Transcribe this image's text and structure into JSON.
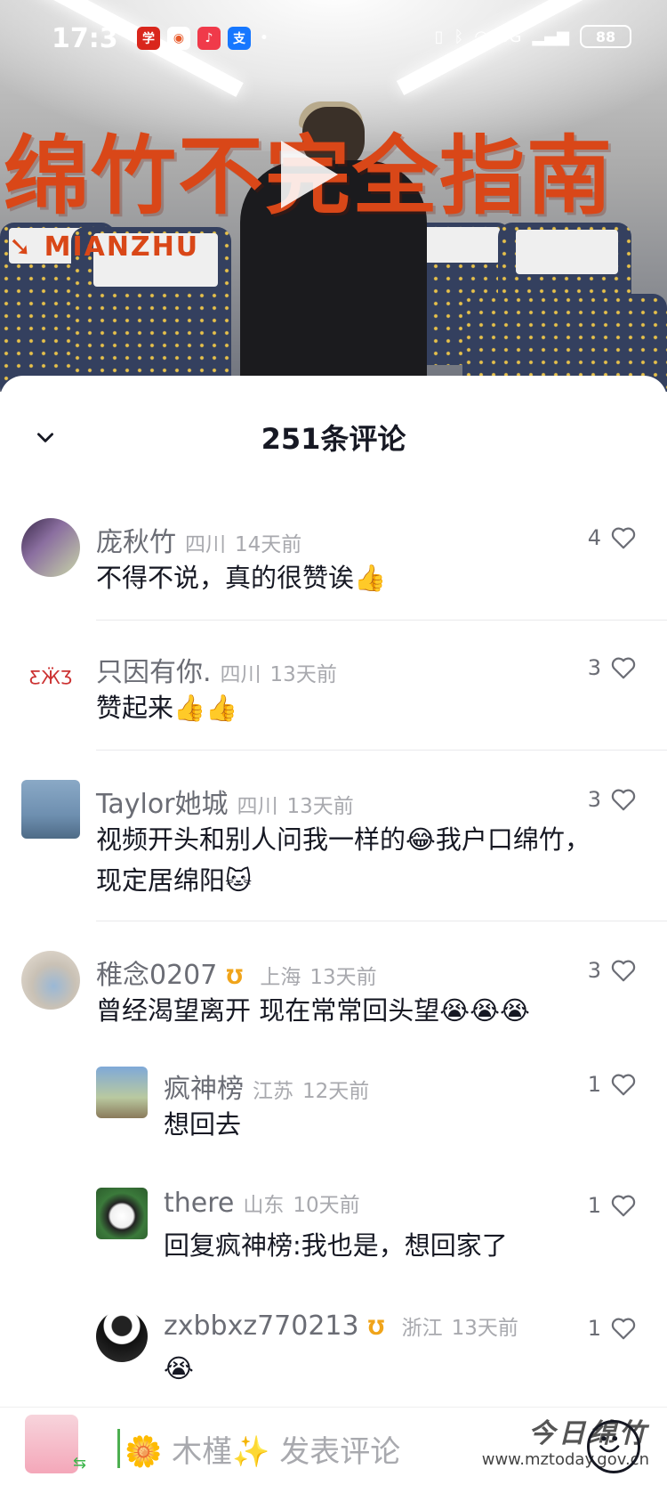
{
  "status_bar": {
    "time": "17:3",
    "battery": "88",
    "network": "5G"
  },
  "video": {
    "title_overlay": "绵竹不完全指南",
    "subtitle_overlay": "MIANZHU"
  },
  "comments_panel": {
    "title": "251条评论",
    "comments": [
      {
        "name": "庞秋竹",
        "location": "四川",
        "time": "14天前",
        "likes": "4",
        "text": "不得不说，真的很赞诶👍"
      },
      {
        "name": "只因有你.",
        "location": "四川",
        "time": "13天前",
        "likes": "3",
        "text": "赞起来👍👍"
      },
      {
        "name": "Taylor她城",
        "location": "四川",
        "time": "13天前",
        "likes": "3",
        "text_line1": "视频开头和别人问我一样的😂我户口绵竹，",
        "text_line2": "现定居绵阳🐱"
      },
      {
        "name": "稚念0207",
        "location": "上海",
        "time": "13天前",
        "likes": "3",
        "text": "曾经渴望离开 现在常常回头望😭😭😭"
      }
    ],
    "replies": [
      {
        "name": "疯神榜",
        "location": "江苏",
        "time": "12天前",
        "likes": "1",
        "text": "想回去"
      },
      {
        "name": "there",
        "location": "山东",
        "time": "10天前",
        "likes": "1",
        "text": "回复疯神榜:我也是，想回家了"
      },
      {
        "name": "zxbbxz770213",
        "location": "浙江",
        "time": "13天前",
        "likes": "1",
        "text": "😭"
      }
    ]
  },
  "compose": {
    "placeholder": "🌼 木槿✨ 发表评论"
  },
  "watermark": {
    "title": "今日绵竹",
    "url": "www.mztoday.gov.cn"
  },
  "colors": {
    "accent_orange": "#d94718",
    "badge_orange": "#f0a41a"
  }
}
